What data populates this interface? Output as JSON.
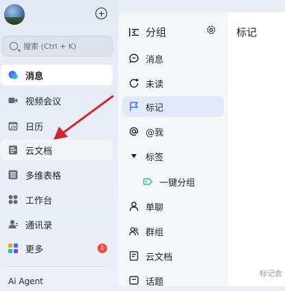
{
  "search": {
    "placeholder": "搜索 (Ctrl + K)"
  },
  "nav": [
    {
      "label": "消息",
      "icon": "message-bubble-icon",
      "active": true
    },
    {
      "label": "视频会议",
      "icon": "video-camera-icon"
    },
    {
      "label": "日历",
      "icon": "calendar-icon"
    },
    {
      "label": "云文档",
      "icon": "cloud-document-icon"
    },
    {
      "label": "多维表格",
      "icon": "base-table-icon"
    },
    {
      "label": "工作台",
      "icon": "workplace-grid-icon"
    },
    {
      "label": "通讯录",
      "icon": "contacts-icon"
    },
    {
      "label": "更多",
      "icon": "more-apps-icon",
      "badge": "1"
    }
  ],
  "nav_bottom_text": "Ai Agent",
  "groups": {
    "title": "分组",
    "items": [
      {
        "label": "消息",
        "icon": "chat-bubble-icon"
      },
      {
        "label": "未读",
        "icon": "unread-icon"
      },
      {
        "label": "标记",
        "icon": "flag-icon",
        "active": true
      },
      {
        "label": "@我",
        "icon": "at-icon"
      },
      {
        "label": "标签",
        "icon": "expand-triangle-icon"
      },
      {
        "label": "一键分组",
        "icon": "tag-icon"
      },
      {
        "label": "单聊",
        "icon": "single-chat-icon"
      },
      {
        "label": "群组",
        "icon": "group-icon"
      },
      {
        "label": "云文档",
        "icon": "document-icon"
      },
      {
        "label": "话题",
        "icon": "topic-icon"
      }
    ]
  },
  "content": {
    "title": "标记",
    "footer": "标记会"
  },
  "colors": {
    "accent": "#3370ff",
    "active_group_bg": "#e1e9fa",
    "arrow": "#d0272e",
    "badge": "#f54a45"
  }
}
